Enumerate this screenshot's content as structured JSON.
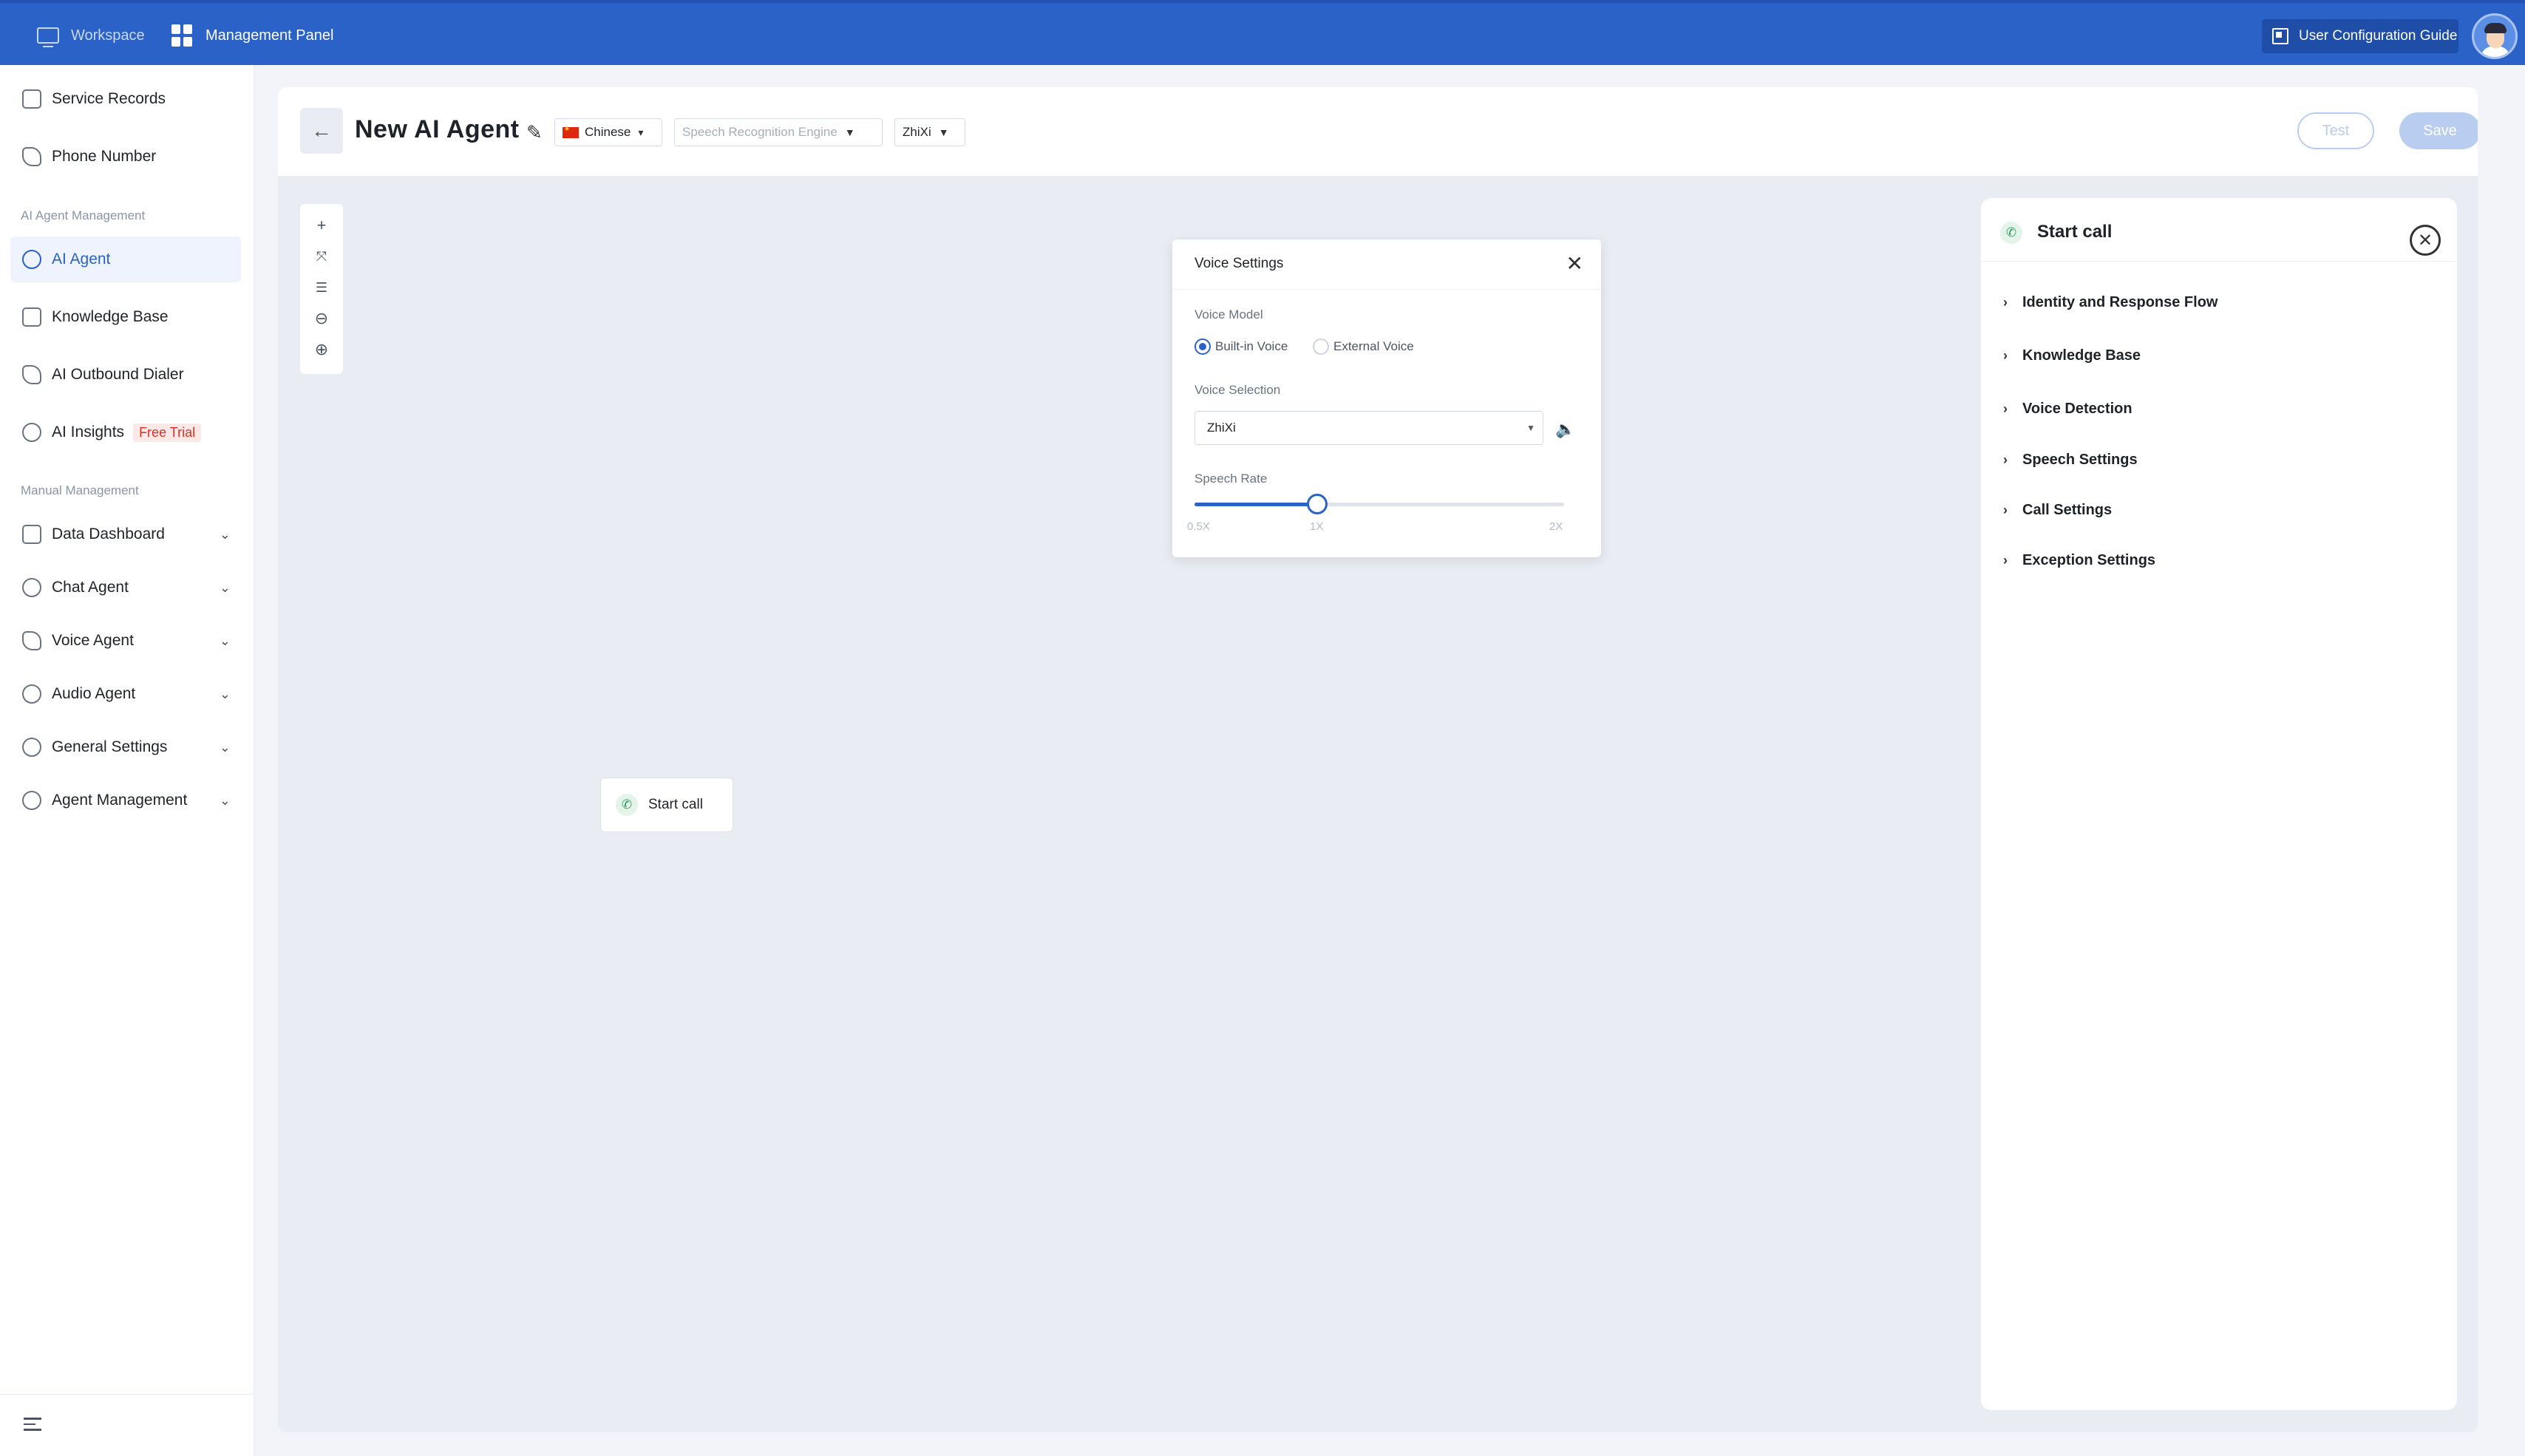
{
  "topbar": {
    "workspace": "Workspace",
    "management_panel": "Management Panel",
    "guide": "User Configuration Guide"
  },
  "sidebar": {
    "items_top": [
      {
        "label": "Service Records",
        "icon": "document-icon"
      },
      {
        "label": "Phone Number",
        "icon": "phone-icon"
      }
    ],
    "section_ai": "AI Agent Management",
    "ai_items": [
      {
        "label": "AI Agent",
        "icon": "gear-icon",
        "active": true
      },
      {
        "label": "Knowledge Base",
        "icon": "database-icon"
      },
      {
        "label": "AI Outbound Dialer",
        "icon": "phone-outgoing-icon"
      },
      {
        "label": "AI Insights",
        "icon": "insights-icon",
        "badge": "Free Trial"
      }
    ],
    "section_manual": "Manual Management",
    "manual_items": [
      {
        "label": "Data Dashboard",
        "icon": "grid-icon"
      },
      {
        "label": "Chat Agent",
        "icon": "headset-icon"
      },
      {
        "label": "Voice Agent",
        "icon": "phone-icon"
      },
      {
        "label": "Audio Agent",
        "icon": "microphone-icon"
      },
      {
        "label": "General Settings",
        "icon": "gear-icon"
      },
      {
        "label": "Agent Management",
        "icon": "users-icon"
      }
    ]
  },
  "header": {
    "title": "New AI Agent",
    "language": "Chinese",
    "engine_placeholder": "Speech Recognition Engine",
    "voice": "ZhiXi",
    "test": "Test",
    "save": "Save"
  },
  "canvas": {
    "node_label": "Start call"
  },
  "voice_settings": {
    "title": "Voice Settings",
    "model_label": "Voice Model",
    "builtin": "Built-in Voice",
    "external": "External Voice",
    "selection_label": "Voice Selection",
    "selection_value": "ZhiXi",
    "rate_label": "Speech Rate",
    "rate_min": "0.5X",
    "rate_mid": "1X",
    "rate_max": "2X",
    "rate_value": 1.0
  },
  "panel": {
    "title": "Start call",
    "sections": [
      "Identity and Response Flow",
      "Knowledge Base",
      "Voice Detection",
      "Speech Settings",
      "Call Settings",
      "Exception Settings"
    ]
  },
  "colors": {
    "brand": "#2b62c8",
    "trial_badge": "#d93025"
  }
}
